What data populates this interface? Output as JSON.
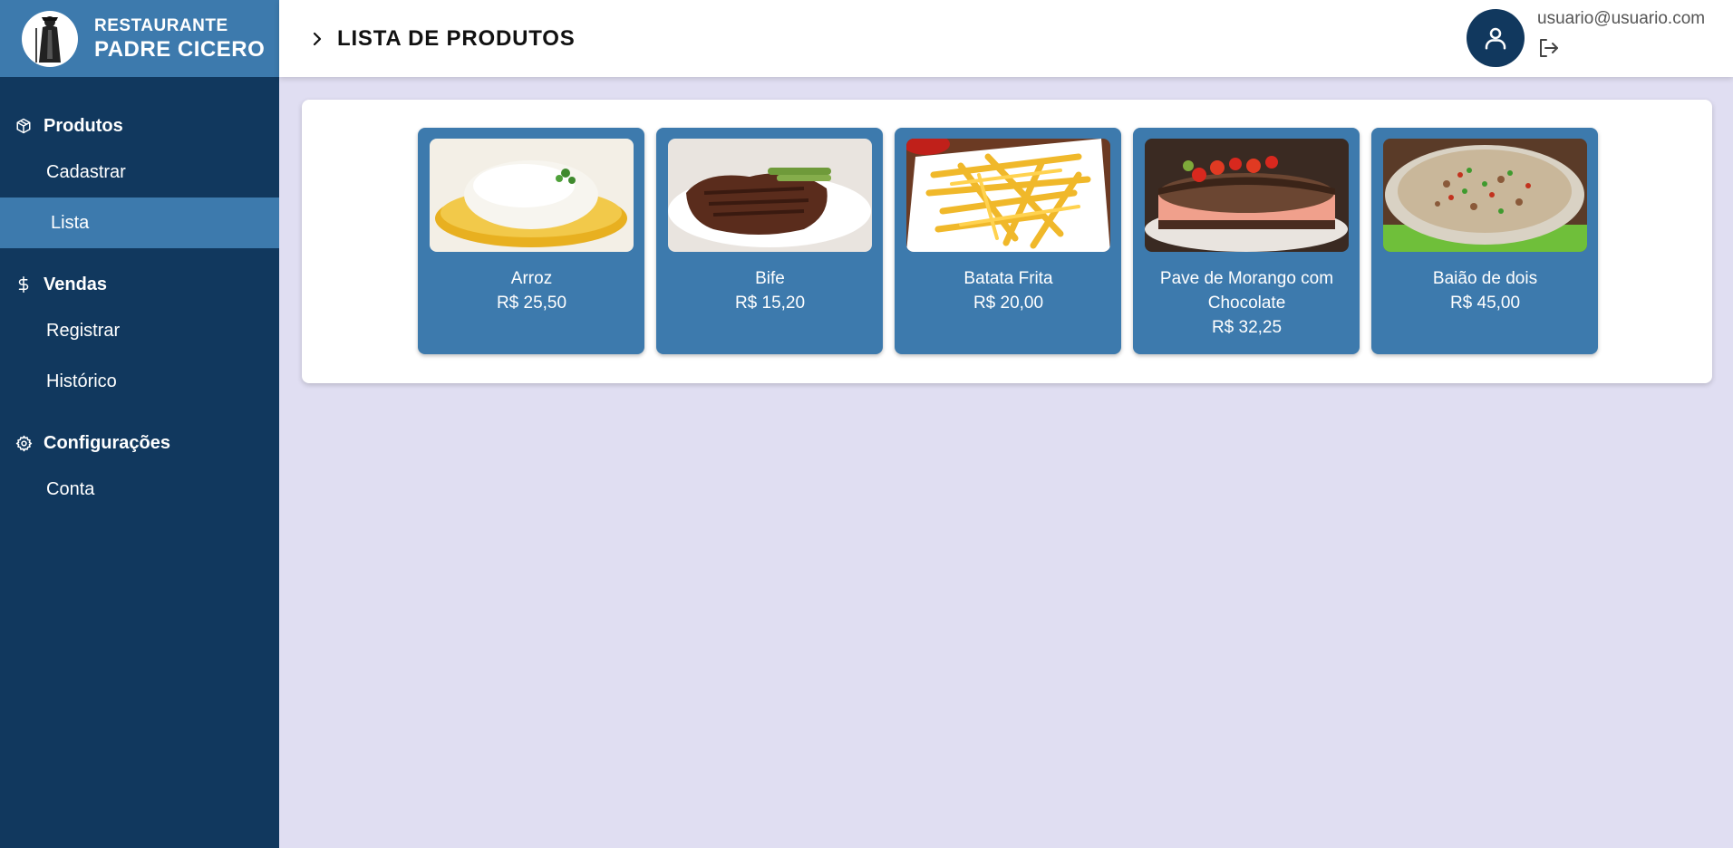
{
  "brand": {
    "line1": "RESTAURANTE",
    "line2": "PADRE CICERO"
  },
  "sidebar": {
    "sections": [
      {
        "title": "Produtos",
        "icon": "box-icon",
        "items": [
          {
            "label": "Cadastrar",
            "active": false
          },
          {
            "label": "Lista",
            "active": true
          }
        ]
      },
      {
        "title": "Vendas",
        "icon": "dollar-icon",
        "items": [
          {
            "label": "Registrar",
            "active": false
          },
          {
            "label": "Histórico",
            "active": false
          }
        ]
      },
      {
        "title": "Configurações",
        "icon": "gear-icon",
        "items": [
          {
            "label": "Conta",
            "active": false
          }
        ]
      }
    ]
  },
  "header": {
    "title": "LISTA DE PRODUTOS",
    "user_email": "usuario@usuario.com"
  },
  "products": [
    {
      "name": "Arroz",
      "price": "R$ 25,50"
    },
    {
      "name": "Bife",
      "price": "R$ 15,20"
    },
    {
      "name": "Batata Frita",
      "price": "R$ 20,00"
    },
    {
      "name": "Pave de Morango com Chocolate",
      "price": "R$ 32,25"
    },
    {
      "name": "Baião de dois",
      "price": "R$ 45,00"
    }
  ],
  "colors": {
    "sidebar": "#11385e",
    "accent": "#3d7aad",
    "background": "#e0def2"
  }
}
